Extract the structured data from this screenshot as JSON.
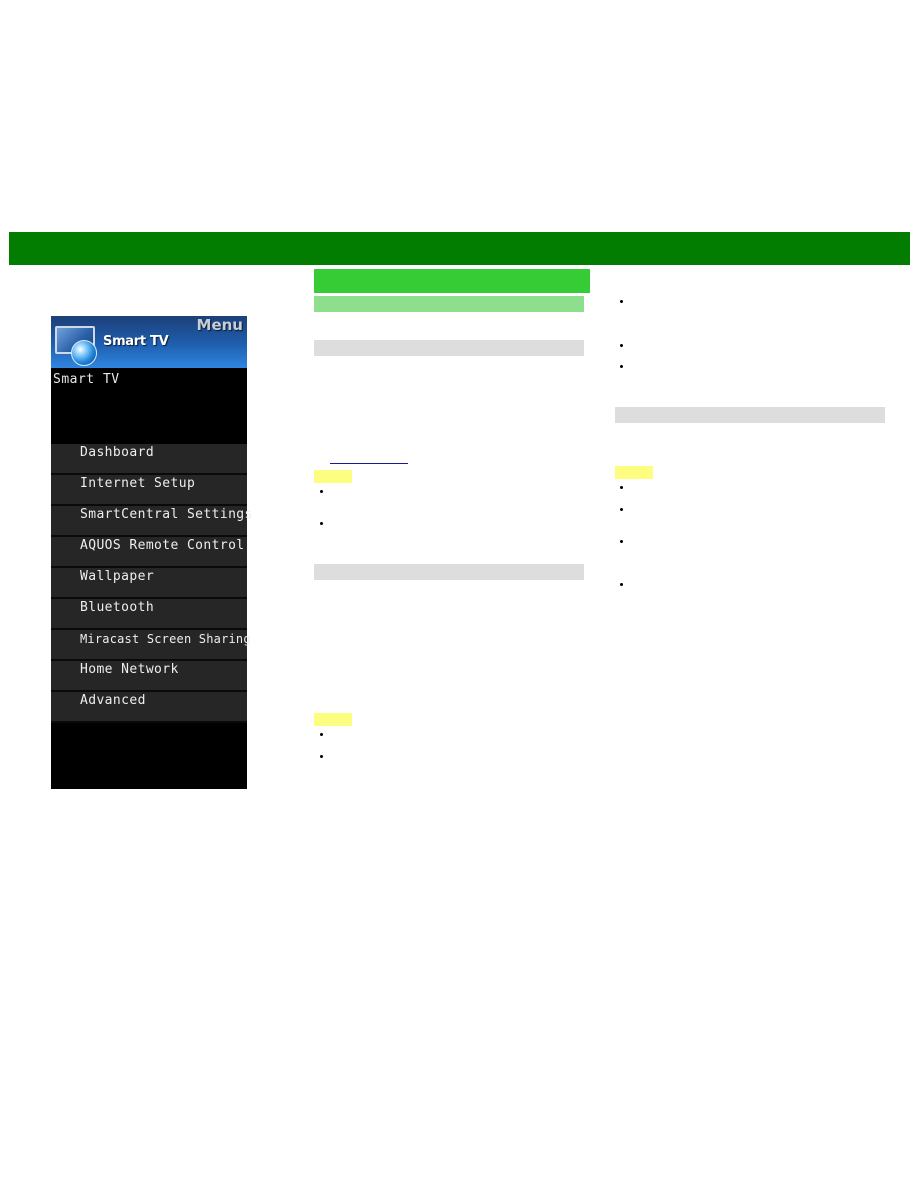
{
  "header_bar": {
    "color": "#027d02"
  },
  "tv_menu": {
    "menu_label": "Menu",
    "header_title": "Smart TV",
    "section_title": "Smart TV",
    "header_icon": "smart-tv-globe-icon",
    "items": [
      {
        "label": "Dashboard"
      },
      {
        "label": "Internet Setup"
      },
      {
        "label": "SmartCentral Settings"
      },
      {
        "label": "AQUOS Remote Control"
      },
      {
        "label": "Wallpaper"
      },
      {
        "label": "Bluetooth"
      },
      {
        "label": "Miracast Screen Sharing"
      },
      {
        "label": "Home Network"
      },
      {
        "label": "Advanced"
      }
    ]
  },
  "content": {
    "section_heading_color": "#36cc36",
    "subheading_color": "#8ddf8d",
    "subsection_bar_color": "#dddddd",
    "note_tag_color": "#fdfd80",
    "link_color": "#1b1b8f"
  }
}
